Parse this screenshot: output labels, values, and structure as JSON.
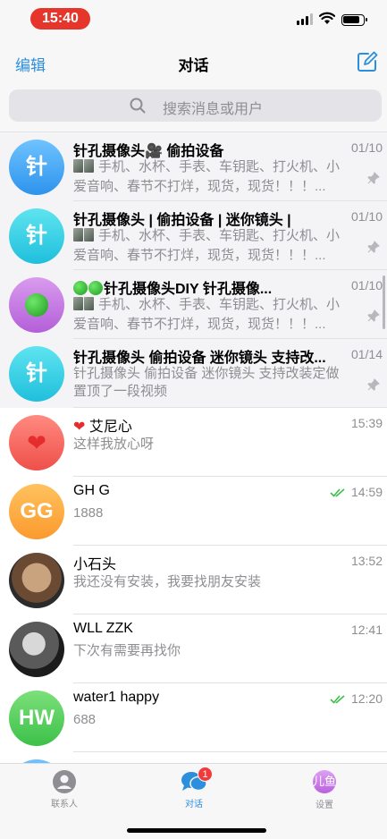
{
  "status_bar": {
    "time": "15:40"
  },
  "nav": {
    "edit_label": "编辑",
    "title": "对话"
  },
  "search": {
    "placeholder": "搜索消息或用户"
  },
  "chats": [
    {
      "avatar_text": "针",
      "name": "针孔摄像头🎥 偷拍设备",
      "date": "01/10",
      "preview": "手机、水杯、手表、车钥匙、打火机、小爱音响、春节不打烊，现货，现货！！！...",
      "pinned": true
    },
    {
      "avatar_text": "针",
      "name": "针孔摄像头 | 偷拍设备 | 迷你镜头 |",
      "date": "01/10",
      "preview": "手机、水杯、手表、车钥匙、打火机、小爱音响、春节不打烊，现货，现货！！！...",
      "pinned": true
    },
    {
      "avatar_text": "",
      "name": "针孔摄像头DIY 针孔摄像...",
      "date": "01/10",
      "preview": "手机、水杯、手表、车钥匙、打火机、小爱音响、春节不打烊，现货，现货！！！...",
      "pinned": true
    },
    {
      "avatar_text": "针",
      "name": "针孔摄像头 偷拍设备 迷你镜头 支持改...",
      "date": "01/14",
      "preview": "针孔摄像头 偷拍设备 迷你镜头 支持改装定做置顶了一段视频",
      "pinned": true
    },
    {
      "avatar_text": "",
      "name": "艾尼心",
      "date": "15:39",
      "preview": "这样我放心呀",
      "pinned": false
    },
    {
      "avatar_text": "GG",
      "name": "GH G",
      "date": "14:59",
      "preview": "1888",
      "pinned": false
    },
    {
      "avatar_text": "",
      "name": "小石头",
      "date": "13:52",
      "preview": "我还没有安装，我要找朋友安装",
      "pinned": false
    },
    {
      "avatar_text": "",
      "name": "WLL ZZK",
      "date": "12:41",
      "preview": "下次有需要再找你",
      "pinned": false
    },
    {
      "avatar_text": "HW",
      "name": "water1 happy",
      "date": "12:20",
      "preview": "688",
      "pinned": false
    }
  ],
  "tabs": [
    {
      "label": "联系人",
      "icon": "person-icon"
    },
    {
      "label": "对话",
      "icon": "chat-bubbles-icon",
      "badge": "1"
    },
    {
      "label": "设置",
      "icon": "avatar",
      "avatar_text": "儿鱼"
    }
  ],
  "colors": {
    "accent": "#2c8fdd",
    "badge": "#f23a3a",
    "read_check": "#3cbf4a"
  }
}
